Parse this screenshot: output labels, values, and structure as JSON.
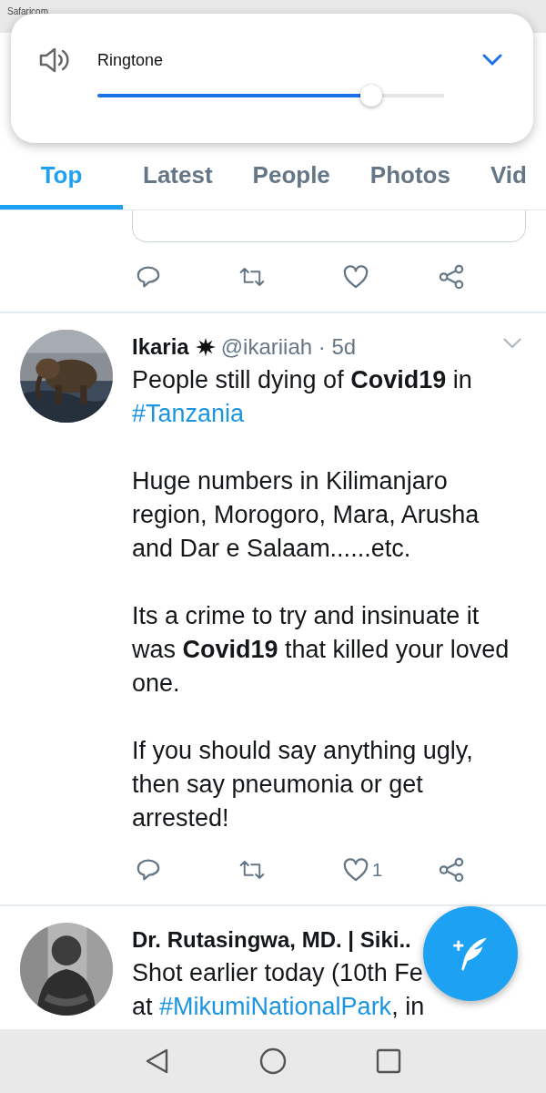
{
  "status_bar": {
    "carrier": "Safaricom"
  },
  "volume_panel": {
    "label": "Ringtone",
    "level": 0.79,
    "expanded": false
  },
  "tabs": [
    {
      "label": "Top",
      "selected": true
    },
    {
      "label": "Latest",
      "selected": false
    },
    {
      "label": "People",
      "selected": false
    },
    {
      "label": "Photos",
      "selected": false
    },
    {
      "label": "Vid",
      "selected": false
    }
  ],
  "tweets": [
    {
      "kind": "partial",
      "actions": {
        "liked": false
      }
    },
    {
      "kind": "full",
      "name": "Ikaria",
      "badge": true,
      "handle": "@ikariiah · 5d",
      "paragraphs": [
        [
          {
            "kind": "text",
            "text": "People still dying of **Covid19** in "
          },
          {
            "kind": "hashtag",
            "text": "#Tanzania"
          }
        ],
        [
          {
            "kind": "text",
            "text": "Huge numbers in Kilimanjaro region, Morogoro, Mara, Arusha and Dar e Salaam......etc."
          }
        ],
        [
          {
            "kind": "text",
            "text": "Its a crime to try and insinuate it was **Covid19** that killed your loved one."
          }
        ],
        [
          {
            "kind": "text",
            "text": "If you should say anything ugly, then say pneumonia or get arrested!"
          }
        ]
      ],
      "actions": {
        "likes": "1",
        "liked": false
      }
    },
    {
      "kind": "cut",
      "name": "Dr. Rutasingwa, MD. | Siki..",
      "badge": false,
      "lines": [
        [
          {
            "kind": "text",
            "text": "Shot earlier today (10th Fe"
          }
        ],
        [
          {
            "kind": "text",
            "text": "at "
          },
          {
            "kind": "hashtag",
            "text": "#MikumiNationalPark"
          },
          {
            "kind": "text",
            "text": ", in"
          }
        ]
      ]
    }
  ]
}
